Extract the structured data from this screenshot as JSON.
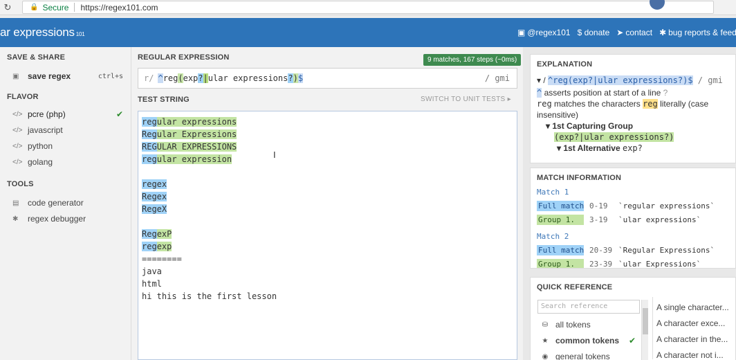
{
  "browser": {
    "secure_label": "Secure",
    "url": "https://regex101.com"
  },
  "header": {
    "logo": "ar expressions",
    "logo_suffix": "101",
    "links": [
      {
        "icon": "twitter-icon",
        "label": "@regex101"
      },
      {
        "icon": "dollar-icon",
        "label": "$ donate"
      },
      {
        "icon": "send-icon",
        "label": "contact"
      },
      {
        "icon": "bug-icon",
        "label": "bug reports & feedb"
      }
    ]
  },
  "sidebar": {
    "save_share": "SAVE & SHARE",
    "save_regex": {
      "label": "save regex",
      "shortcut": "ctrl+s"
    },
    "flavor": "FLAVOR",
    "flavors": [
      {
        "label": "pcre (php)",
        "selected": true
      },
      {
        "label": "javascript",
        "selected": false
      },
      {
        "label": "python",
        "selected": false
      },
      {
        "label": "golang",
        "selected": false
      }
    ],
    "tools": "TOOLS",
    "tool_items": [
      {
        "label": "code generator"
      },
      {
        "label": "regex debugger"
      }
    ]
  },
  "main": {
    "regex_title": "REGULAR EXPRESSION",
    "matches_badge": "9 matches, 167 steps (~0ms)",
    "regex_prefix": "r/",
    "regex_parts": [
      "^",
      "reg",
      "(",
      "exp",
      "?",
      "|",
      "ular expressions",
      "?",
      ")",
      "$"
    ],
    "flags": "/ gmi",
    "test_title": "TEST STRING",
    "switch_unit": "SWITCH TO UNIT TESTS",
    "lines": [
      {
        "segs": [
          [
            "reg",
            "b"
          ],
          [
            "ular expressions",
            "g"
          ]
        ]
      },
      {
        "segs": [
          [
            "Reg",
            "b"
          ],
          [
            "ular Expressions",
            "g"
          ]
        ]
      },
      {
        "segs": [
          [
            "REG",
            "b"
          ],
          [
            "ULAR EXPRESSIONS",
            "g"
          ]
        ]
      },
      {
        "segs": [
          [
            "reg",
            "b"
          ],
          [
            "ular expression",
            "g"
          ]
        ]
      },
      {
        "segs": [
          [
            "",
            ""
          ]
        ]
      },
      {
        "segs": [
          [
            "regex",
            "b"
          ]
        ]
      },
      {
        "segs": [
          [
            "Regex",
            "b"
          ]
        ]
      },
      {
        "segs": [
          [
            "RegeX",
            "b"
          ]
        ]
      },
      {
        "segs": [
          [
            "",
            ""
          ]
        ]
      },
      {
        "segs": [
          [
            "Reg",
            "b"
          ],
          [
            "exP",
            "g"
          ]
        ]
      },
      {
        "segs": [
          [
            "reg",
            "b"
          ],
          [
            "exp",
            "g"
          ]
        ]
      },
      {
        "segs": [
          [
            "========",
            ""
          ]
        ]
      },
      {
        "segs": [
          [
            "java",
            ""
          ]
        ]
      },
      {
        "segs": [
          [
            "html",
            ""
          ]
        ]
      },
      {
        "segs": [
          [
            "hi this is the first lesson",
            ""
          ]
        ]
      }
    ]
  },
  "explanation": {
    "title": "EXPLANATION",
    "line1_prefix": "▾ / ",
    "line1_regex": "^reg(exp?|ular expressions?)$",
    "line1_flags": " / gmi",
    "line2_token": "^",
    "line2_text": " asserts position at start of a line",
    "line3_token": "reg",
    "line3_text_a": " matches the characters ",
    "line3_token2": "reg",
    "line3_text_b": " literally (case",
    "line4_text": "insensitive)",
    "group_title": "▾ 1st Capturing Group",
    "group_regex": "(exp?|ular expressions?)",
    "alt_title": "▾ 1st Alternative",
    "alt_regex": "exp?"
  },
  "match_info": {
    "title": "MATCH INFORMATION",
    "matches": [
      {
        "label": "Match 1",
        "rows": [
          {
            "tag": "Full match",
            "kind": "full",
            "range": "0-19",
            "value": "`regular expressions`"
          },
          {
            "tag": "Group 1.",
            "kind": "grp",
            "range": "3-19",
            "value": "`ular expressions`"
          }
        ]
      },
      {
        "label": "Match 2",
        "rows": [
          {
            "tag": "Full match",
            "kind": "full",
            "range": "20-39",
            "value": "`Regular Expressions`"
          },
          {
            "tag": "Group 1.",
            "kind": "grp",
            "range": "23-39",
            "value": "`ular Expressions`"
          }
        ]
      }
    ]
  },
  "quick_ref": {
    "title": "QUICK REFERENCE",
    "search_placeholder": "Search reference",
    "categories": [
      {
        "icon": "database-icon",
        "label": "all tokens",
        "selected": false
      },
      {
        "icon": "star-icon",
        "label": "common tokens",
        "selected": true
      },
      {
        "icon": "target-icon",
        "label": "general tokens",
        "selected": false
      }
    ],
    "descriptions": [
      "A single character...",
      "A character exce...",
      "A character in the...",
      "A character not i..."
    ]
  }
}
